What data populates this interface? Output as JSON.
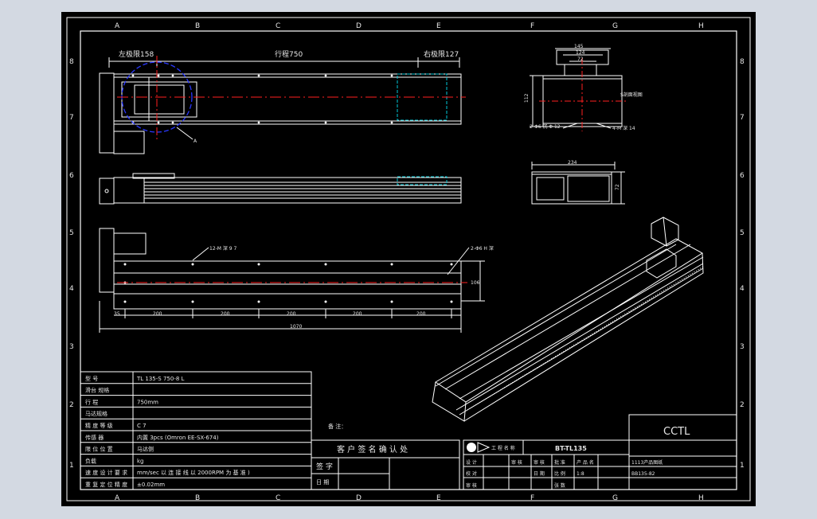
{
  "colors": {
    "line": "#ffffff",
    "centerline": "#ff2020",
    "highlight": "#00c8d8",
    "circle": "#2a38ff",
    "text": "#e6e6e6"
  },
  "grid": {
    "columns": [
      "A",
      "B",
      "C",
      "D",
      "E",
      "F",
      "G",
      "H"
    ],
    "rows": [
      "8",
      "7",
      "6",
      "5",
      "4",
      "3",
      "2",
      "1"
    ]
  },
  "front_view": {
    "left_limit": "左极限158",
    "stroke": "行程750",
    "right_limit": "右极限127",
    "callout": "A"
  },
  "side_view": {
    "width": "145",
    "inner1": "124",
    "inner2": "72",
    "height": "112",
    "note": "S剖面视图",
    "hole_left": "2-Φ6 沉 Φ 12",
    "hole_right": "4-M 深 14"
  },
  "section_view": {
    "width": "234",
    "height": "72"
  },
  "bottom_view": {
    "holes_top": "12-M 深 9 7",
    "holes_right": "2-Φ6 H 深",
    "pitch1": "35",
    "pitch": [
      "200",
      "200",
      "200",
      "200",
      "200"
    ],
    "overall": "1070",
    "height_dim": "106"
  },
  "spec_table": {
    "rows": [
      {
        "label": "型 号",
        "value": "TL 135-S 750-8 L"
      },
      {
        "label": "滑台 规格",
        "value": ""
      },
      {
        "label": "行 程",
        "value": "750mm"
      },
      {
        "label": "马达规格",
        "value": ""
      },
      {
        "label": "精 度 等 级",
        "value": "C 7"
      },
      {
        "label": "传感 器",
        "value": "内置 3pcs (Omron EE-SX-674)"
      },
      {
        "label": "限 位 位 置",
        "value": "马达侧"
      },
      {
        "label": "负载",
        "value": "kg"
      },
      {
        "label": "速 度 设 计 要 求",
        "value": "mm/sec 以 连 接 线 以 2000RPM 为 基 准 )"
      },
      {
        "label": "重 复 定 位 精 度",
        "value": "±0.02mm"
      }
    ]
  },
  "note_label": "备 注：",
  "confirm": {
    "title": "客 户 签 名 确 认 处",
    "sign_label": "签 字",
    "date_label": "日 期"
  },
  "title_block": {
    "logo_text": "工 程 名 称",
    "drawing_name": "BT-TL135",
    "company": "CCTL",
    "rows": [
      {
        "c1": "设 计",
        "c2": "审 核",
        "c3": "审 核",
        "c4": "批 准",
        "c5": "产 品 名",
        "c6": "1113产品图纸"
      },
      {
        "c1": "校 对",
        "c2": "",
        "c3": "日 期",
        "c4": "比 例",
        "c5": "1:8",
        "c6": "BB135-82"
      },
      {
        "c1": "审 核",
        "c2": "",
        "c3": "",
        "c4": "张 数",
        "c5": "",
        "c6": ""
      }
    ]
  }
}
